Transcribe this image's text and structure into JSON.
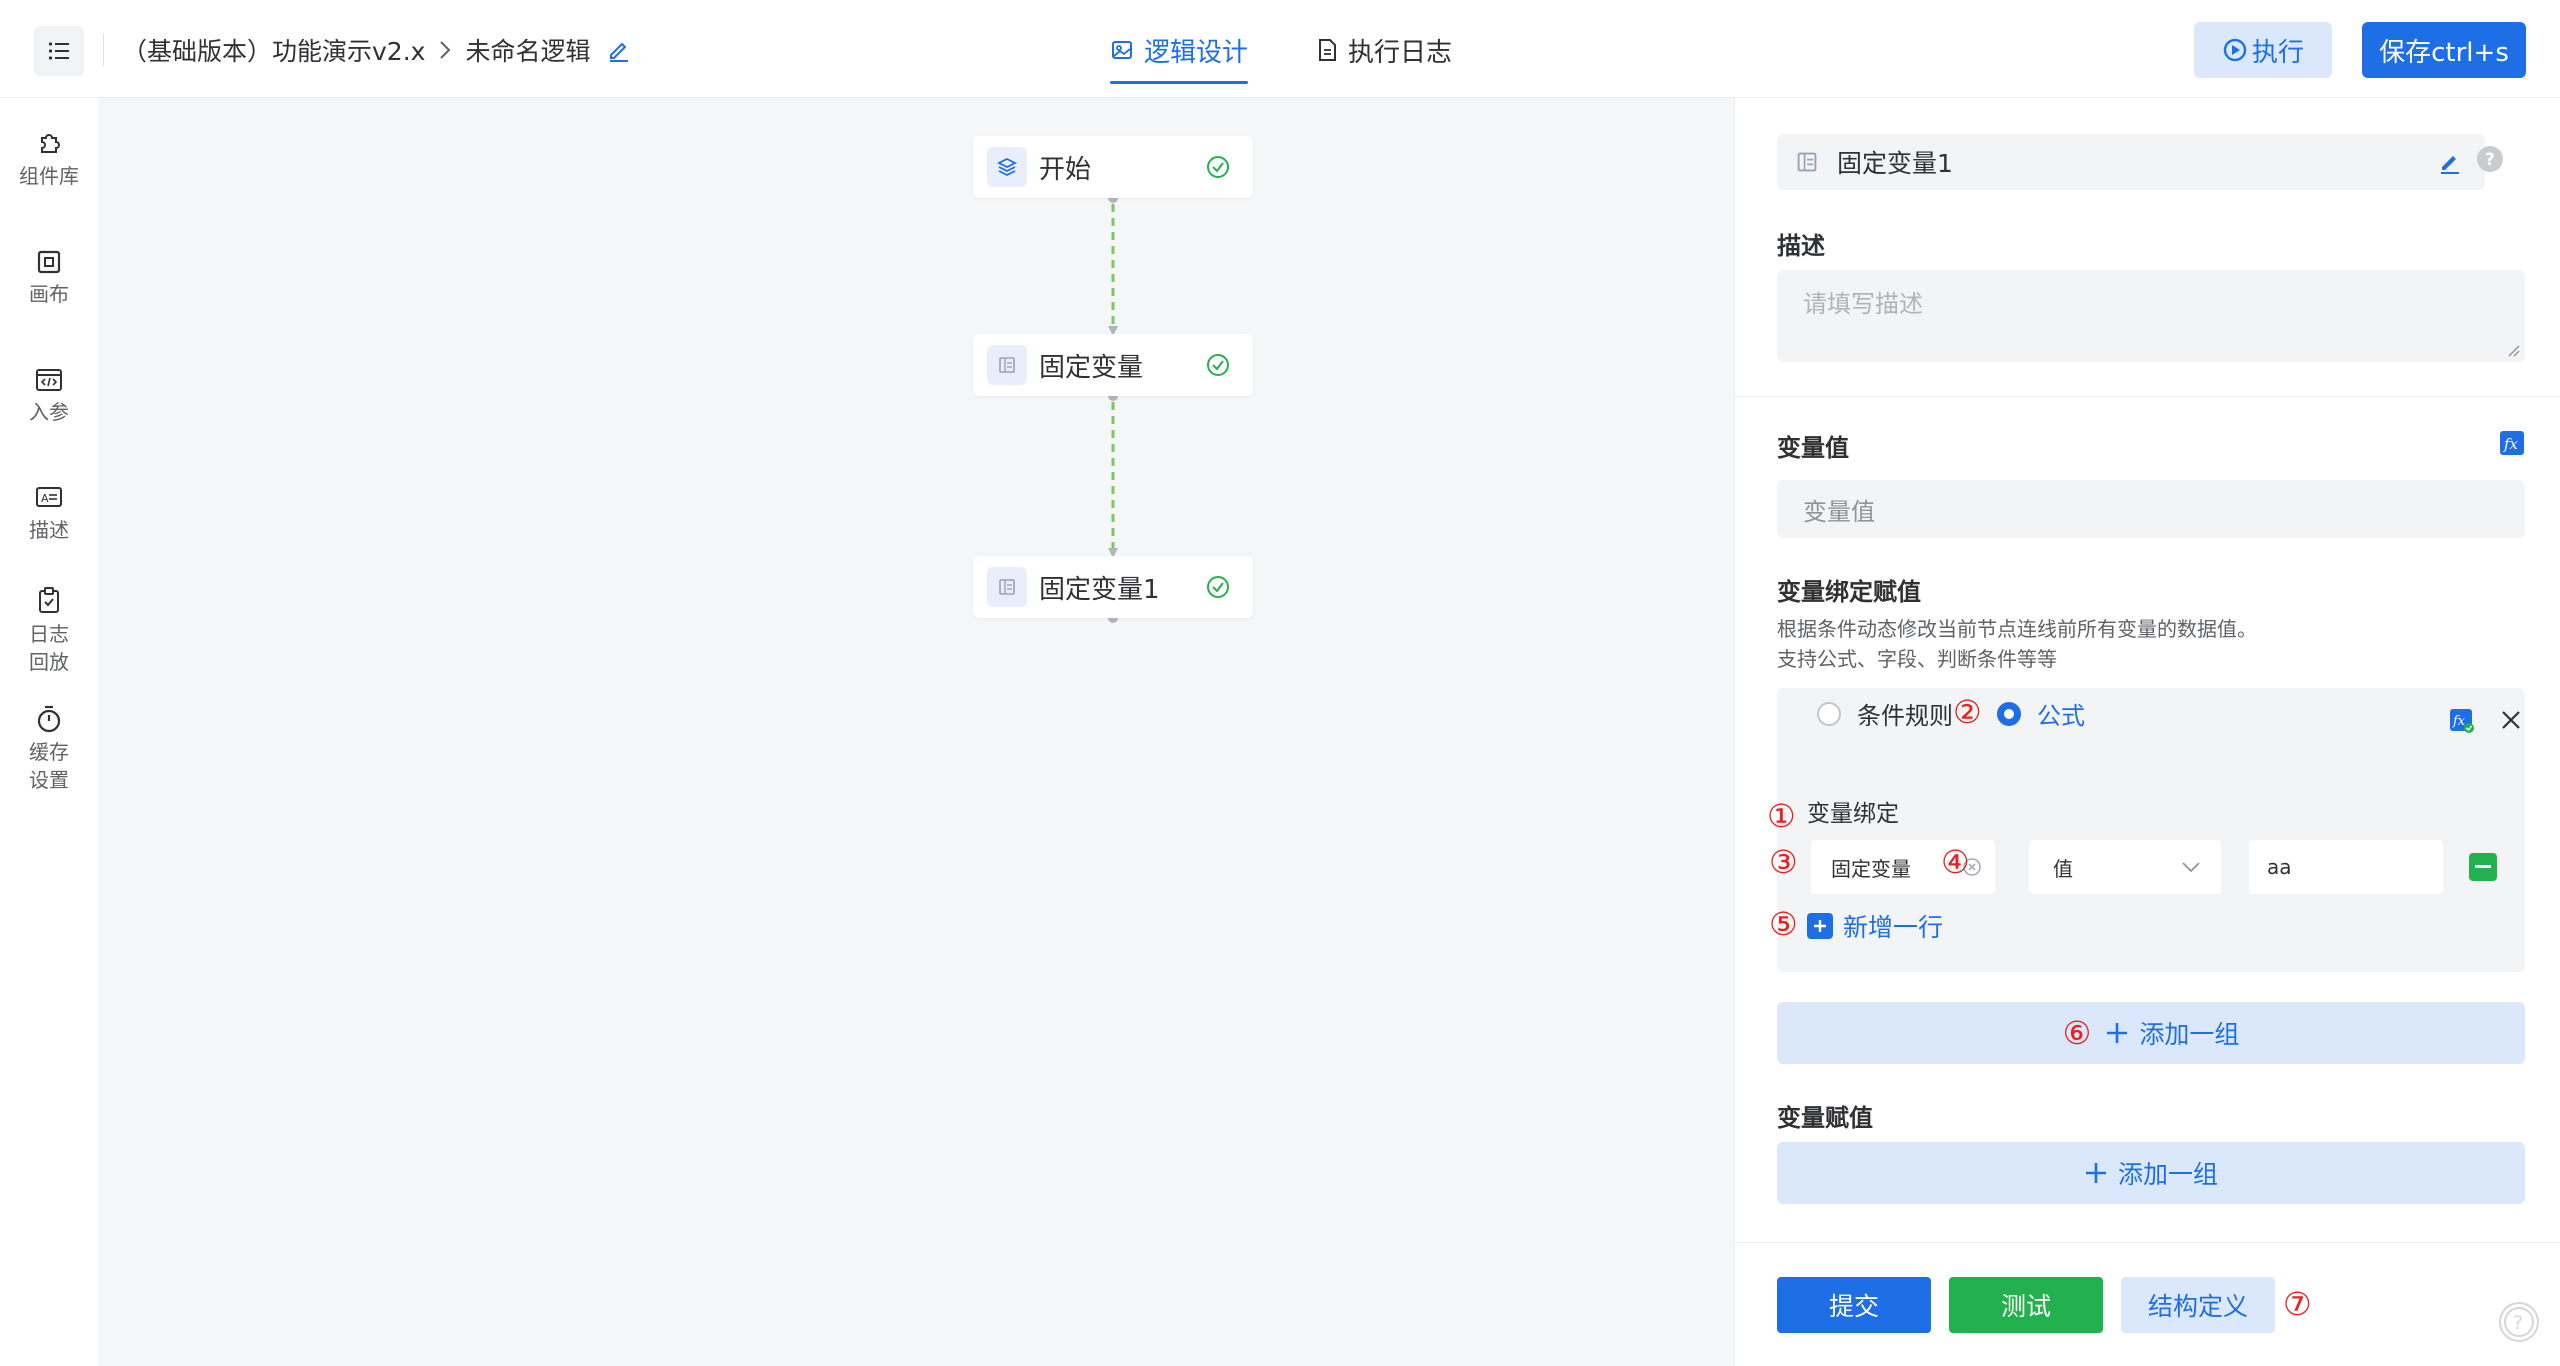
{
  "header": {
    "breadcrumb": [
      "（基础版本）功能演示v2.x",
      "未命名逻辑"
    ],
    "tabs": [
      {
        "label": "逻辑设计",
        "active": true
      },
      {
        "label": "执行日志",
        "active": false
      }
    ],
    "run_label": "执行",
    "save_label": "保存ctrl+s"
  },
  "sidebar": {
    "items": [
      {
        "label": "组件库",
        "icon": "puzzle-icon"
      },
      {
        "label": "画布",
        "icon": "canvas-icon"
      },
      {
        "label": "入参",
        "icon": "code-icon"
      },
      {
        "label": "描述",
        "icon": "description-icon"
      },
      {
        "label": "日志\n回放",
        "icon": "clipboard-icon"
      },
      {
        "label": "缓存\n设置",
        "icon": "timer-icon"
      }
    ]
  },
  "canvas": {
    "nodes": [
      {
        "label": "开始",
        "icon": "layers-icon",
        "status": "ok"
      },
      {
        "label": "固定变量",
        "icon": "variable-icon",
        "status": "ok"
      },
      {
        "label": "固定变量1",
        "icon": "variable-icon",
        "status": "ok"
      }
    ]
  },
  "panel": {
    "node_name": "固定变量1",
    "desc_title": "描述",
    "desc_placeholder": "请填写描述",
    "value_title": "变量值",
    "value_placeholder": "变量值",
    "binding_title": "变量绑定赋值",
    "binding_hint_1": "根据条件动态修改当前节点连线前所有变量的数据值。",
    "binding_hint_2": "支持公式、字段、判断条件等等",
    "group": {
      "radio_condition": "条件规则",
      "radio_formula": "公式",
      "selected": "公式",
      "bind_label": "变量绑定",
      "row": {
        "variable": "固定变量",
        "type": "值",
        "value": "aa"
      },
      "add_row_label": "新增一行"
    },
    "add_group_label": "添加一组",
    "assign_title": "变量赋值",
    "assign_add_group_label": "添加一组",
    "buttons": {
      "submit": "提交",
      "test": "测试",
      "struct": "结构定义"
    }
  },
  "annotations": [
    "①",
    "②",
    "③",
    "④",
    "⑤",
    "⑥",
    "⑦"
  ],
  "colors": {
    "accent": "#1e6fe6",
    "success": "#23b04f",
    "annotation": "#e62020"
  }
}
